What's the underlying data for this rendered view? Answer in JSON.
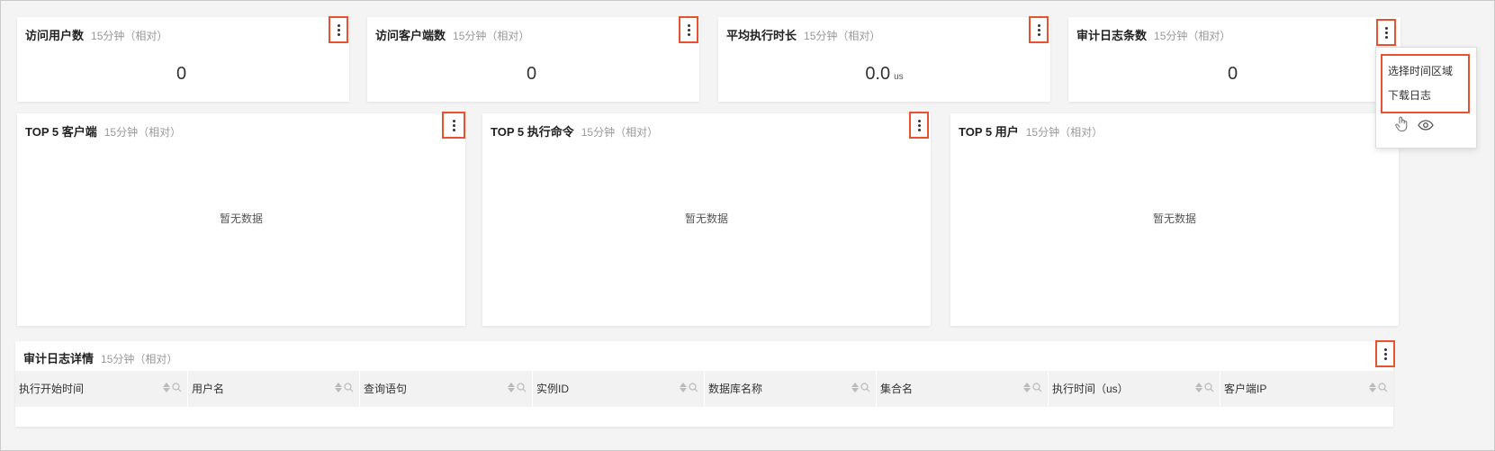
{
  "colors": {
    "highlight": "#e8522f",
    "background": "#f4f4f4",
    "card": "#ffffff"
  },
  "metrics": [
    {
      "title": "访问用户数",
      "subtitle": "15分钟（相对）",
      "value": "0",
      "unit": ""
    },
    {
      "title": "访问客户端数",
      "subtitle": "15分钟（相对）",
      "value": "0",
      "unit": ""
    },
    {
      "title": "平均执行时长",
      "subtitle": "15分钟（相对）",
      "value": "0.0",
      "unit": "us"
    },
    {
      "title": "审计日志条数",
      "subtitle": "15分钟（相对）",
      "value": "0",
      "unit": ""
    }
  ],
  "top_panels": [
    {
      "title": "TOP 5 客户端",
      "subtitle": "15分钟（相对）",
      "empty_text": "暂无数据"
    },
    {
      "title": "TOP 5 执行命令",
      "subtitle": "15分钟（相对）",
      "empty_text": "暂无数据"
    },
    {
      "title": "TOP 5 用户",
      "subtitle": "15分钟（相对）",
      "empty_text": "暂无数据"
    }
  ],
  "menu": {
    "items": [
      "选择时间区域",
      "下载日志"
    ],
    "icons": [
      "hand-pointer-icon",
      "eye-icon"
    ]
  },
  "detail": {
    "title": "审计日志详情",
    "subtitle": "15分钟（相对）",
    "columns": [
      "执行开始时间",
      "用户名",
      "查询语句",
      "实例ID",
      "数据库名称",
      "集合名",
      "执行时间（us）",
      "客户端IP"
    ]
  }
}
